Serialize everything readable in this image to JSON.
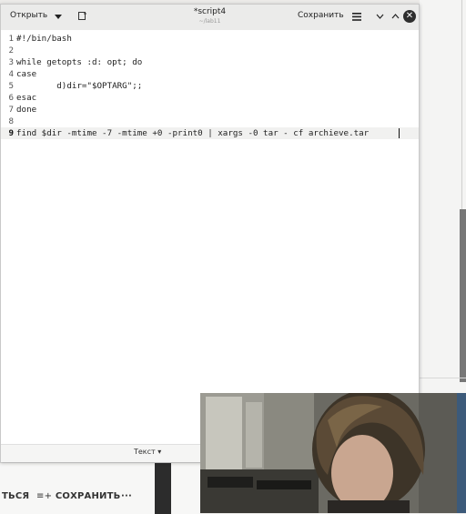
{
  "window": {
    "open_label": "Открыть",
    "title": "*script4",
    "subtitle": "~/lab11",
    "save_label": "Сохранить"
  },
  "editor": {
    "lines": [
      {
        "num": "1",
        "text": "#!/bin/bash"
      },
      {
        "num": "2",
        "text": ""
      },
      {
        "num": "3",
        "text": "while getopts :d: opt; do"
      },
      {
        "num": "4",
        "text": "case"
      },
      {
        "num": "5",
        "text": "        d)dir=\"$OPTARG\";;"
      },
      {
        "num": "6",
        "text": "esac"
      },
      {
        "num": "7",
        "text": "done"
      },
      {
        "num": "8",
        "text": ""
      },
      {
        "num": "9",
        "text": "find $dir -mtime -7 -mtime +0 -print0 | xargs -0 tar - cf archieve.tar"
      }
    ],
    "current_line": "9"
  },
  "status": {
    "mode_label": "Текст ▾"
  },
  "background_app": {
    "left_text": "ТЬСЯ",
    "save_label": "СОХРАНИТЬ",
    "more_label": "···"
  },
  "icons": {
    "dropdown": "chevron-down-icon",
    "new_document": "new-document-icon",
    "menu": "hamburger-menu-icon",
    "minimize": "chevron-down-icon",
    "maximize": "chevron-up-icon",
    "close": "close-icon"
  }
}
